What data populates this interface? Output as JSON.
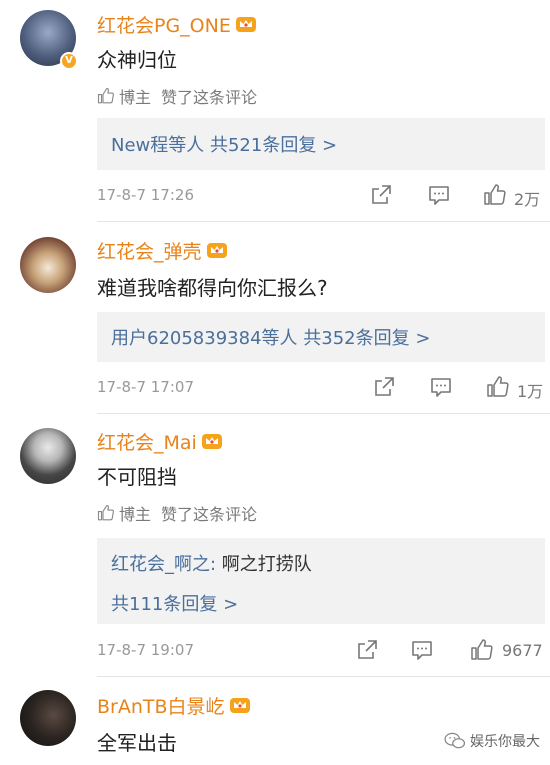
{
  "comments": [
    {
      "username": "红花会PG_ONE",
      "text": "众神归位",
      "liked_by_author": true,
      "liked_label": "博主",
      "liked_text": "赞了这条评论",
      "reply_summary": "New程等人  共521条回复 >",
      "time": "17-8-7 17:26",
      "likes": "2万",
      "avatar_icon": "avatar-anime-figure"
    },
    {
      "username": "红花会_弹壳",
      "text": "难道我啥都得向你汇报么?",
      "liked_by_author": false,
      "reply_summary": "用户6205839384等人  共352条回复 >",
      "time": "17-8-7 17:07",
      "likes": "1万",
      "avatar_icon": "avatar-grill-teeth"
    },
    {
      "username": "红花会_Mai",
      "text": "不可阻挡",
      "liked_by_author": true,
      "liked_label": "博主",
      "liked_text": "赞了这条评论",
      "reply_quote_name": "红花会_啊之:",
      "reply_quote_text": " 啊之打捞队",
      "reply_summary": "共111条回复 >",
      "time": "17-8-7 19:07",
      "likes": "9677",
      "avatar_icon": "avatar-person-hat"
    },
    {
      "username": "BrAnTB白景屹",
      "text": "全军出击",
      "avatar_icon": "avatar-dark-photo"
    }
  ],
  "watermark": "娱乐你最大",
  "icons": {
    "crown": "crown-badge-icon",
    "share": "share-icon",
    "comment": "comment-icon",
    "like": "thumbs-up-icon"
  },
  "colors": {
    "username": "#e8831a",
    "link": "#4a6f9c",
    "meta": "#999999",
    "reply_bg": "#f2f2f2"
  }
}
